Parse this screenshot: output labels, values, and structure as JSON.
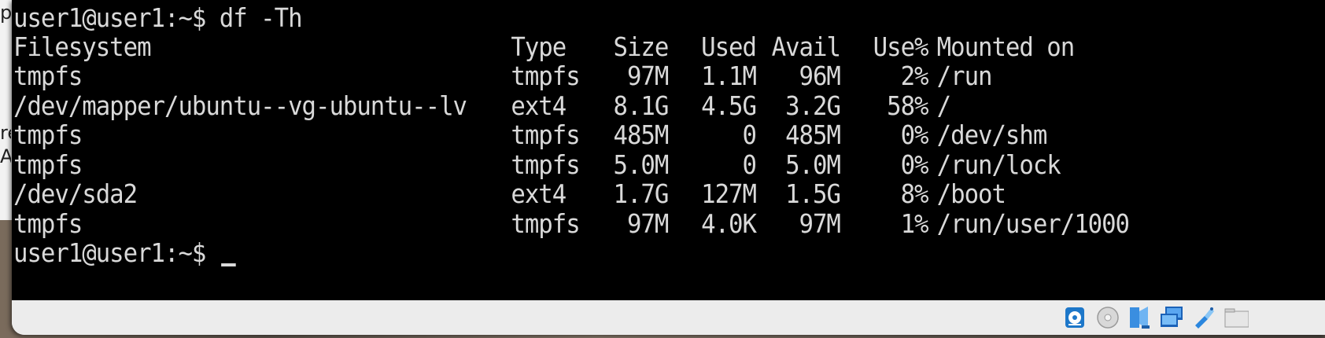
{
  "side_fragments": [
    "pr",
    "re",
    "A"
  ],
  "terminal": {
    "prompt_user": "user1@user1:~$ ",
    "command": "df -Th",
    "headers": {
      "filesystem": "Filesystem",
      "type": "Type",
      "size": "Size",
      "used": "Used",
      "avail": "Avail",
      "use_pct": "Use%",
      "mounted": "Mounted on"
    },
    "rows": [
      {
        "filesystem": "tmpfs",
        "type": "tmpfs",
        "size": "97M",
        "used": "1.1M",
        "avail": "96M",
        "use_pct": "2%",
        "mounted": "/run"
      },
      {
        "filesystem": "/dev/mapper/ubuntu--vg-ubuntu--lv",
        "type": "ext4",
        "size": "8.1G",
        "used": "4.5G",
        "avail": "3.2G",
        "use_pct": "58%",
        "mounted": "/"
      },
      {
        "filesystem": "tmpfs",
        "type": "tmpfs",
        "size": "485M",
        "used": "0",
        "avail": "485M",
        "use_pct": "0%",
        "mounted": "/dev/shm"
      },
      {
        "filesystem": "tmpfs",
        "type": "tmpfs",
        "size": "5.0M",
        "used": "0",
        "avail": "5.0M",
        "use_pct": "0%",
        "mounted": "/run/lock"
      },
      {
        "filesystem": "/dev/sda2",
        "type": "ext4",
        "size": "1.7G",
        "used": "127M",
        "avail": "1.5G",
        "use_pct": "8%",
        "mounted": "/boot"
      },
      {
        "filesystem": "tmpfs",
        "type": "tmpfs",
        "size": "97M",
        "used": "4.0K",
        "avail": "97M",
        "use_pct": "1%",
        "mounted": "/run/user/1000"
      }
    ],
    "final_prompt": "user1@user1:~$ "
  },
  "status_bar": {
    "icons": [
      "hard-disk-icon",
      "optical-drive-icon",
      "audio-icon",
      "network-icon",
      "usb-icon",
      "shared-folders-icon"
    ]
  }
}
